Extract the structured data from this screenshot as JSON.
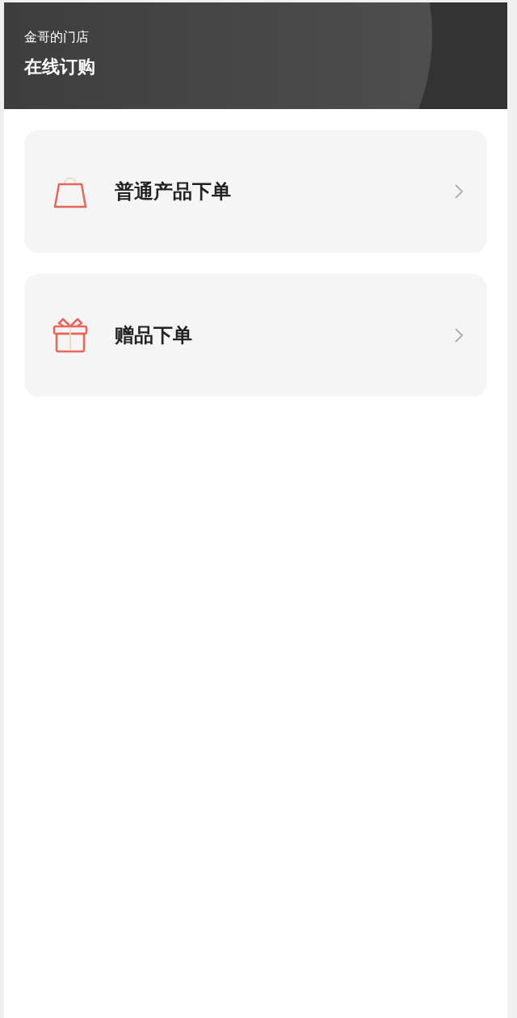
{
  "header": {
    "store_name": "金哥的门店",
    "title": "在线订购"
  },
  "menu_items": [
    {
      "kind": "bag",
      "label": "普通产品下单"
    },
    {
      "kind": "gift",
      "label": "赠品下单"
    }
  ]
}
